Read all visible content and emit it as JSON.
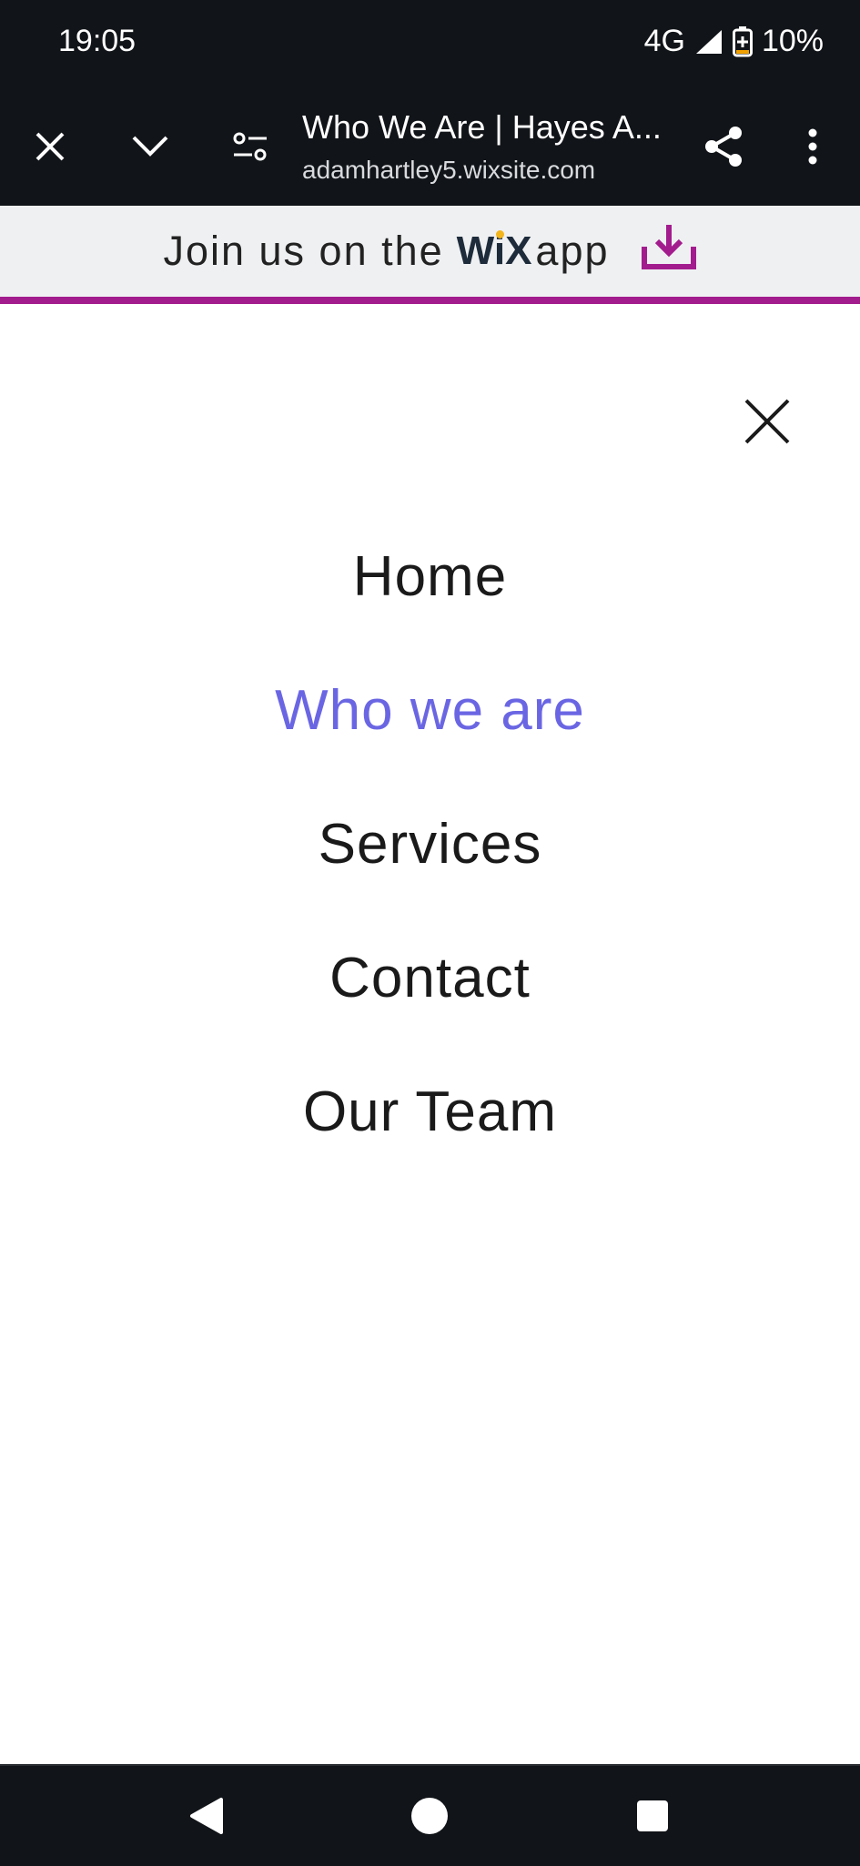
{
  "status": {
    "time": "19:05",
    "network": "4G",
    "battery": "10%"
  },
  "browser": {
    "page_title": "Who We Are | Hayes A...",
    "url": "adamhartley5.wixsite.com"
  },
  "wix_banner": {
    "text_before": "Join us on the",
    "logo": "WiX",
    "text_after": "app"
  },
  "menu": {
    "items": [
      {
        "label": "Home"
      },
      {
        "label": "Who we are",
        "active": true
      },
      {
        "label": "Services"
      },
      {
        "label": "Contact"
      },
      {
        "label": "Our Team"
      }
    ]
  },
  "colors": {
    "active": "#6a66e3",
    "banner_accent": "#a31c8e",
    "system_bar": "#111418"
  }
}
